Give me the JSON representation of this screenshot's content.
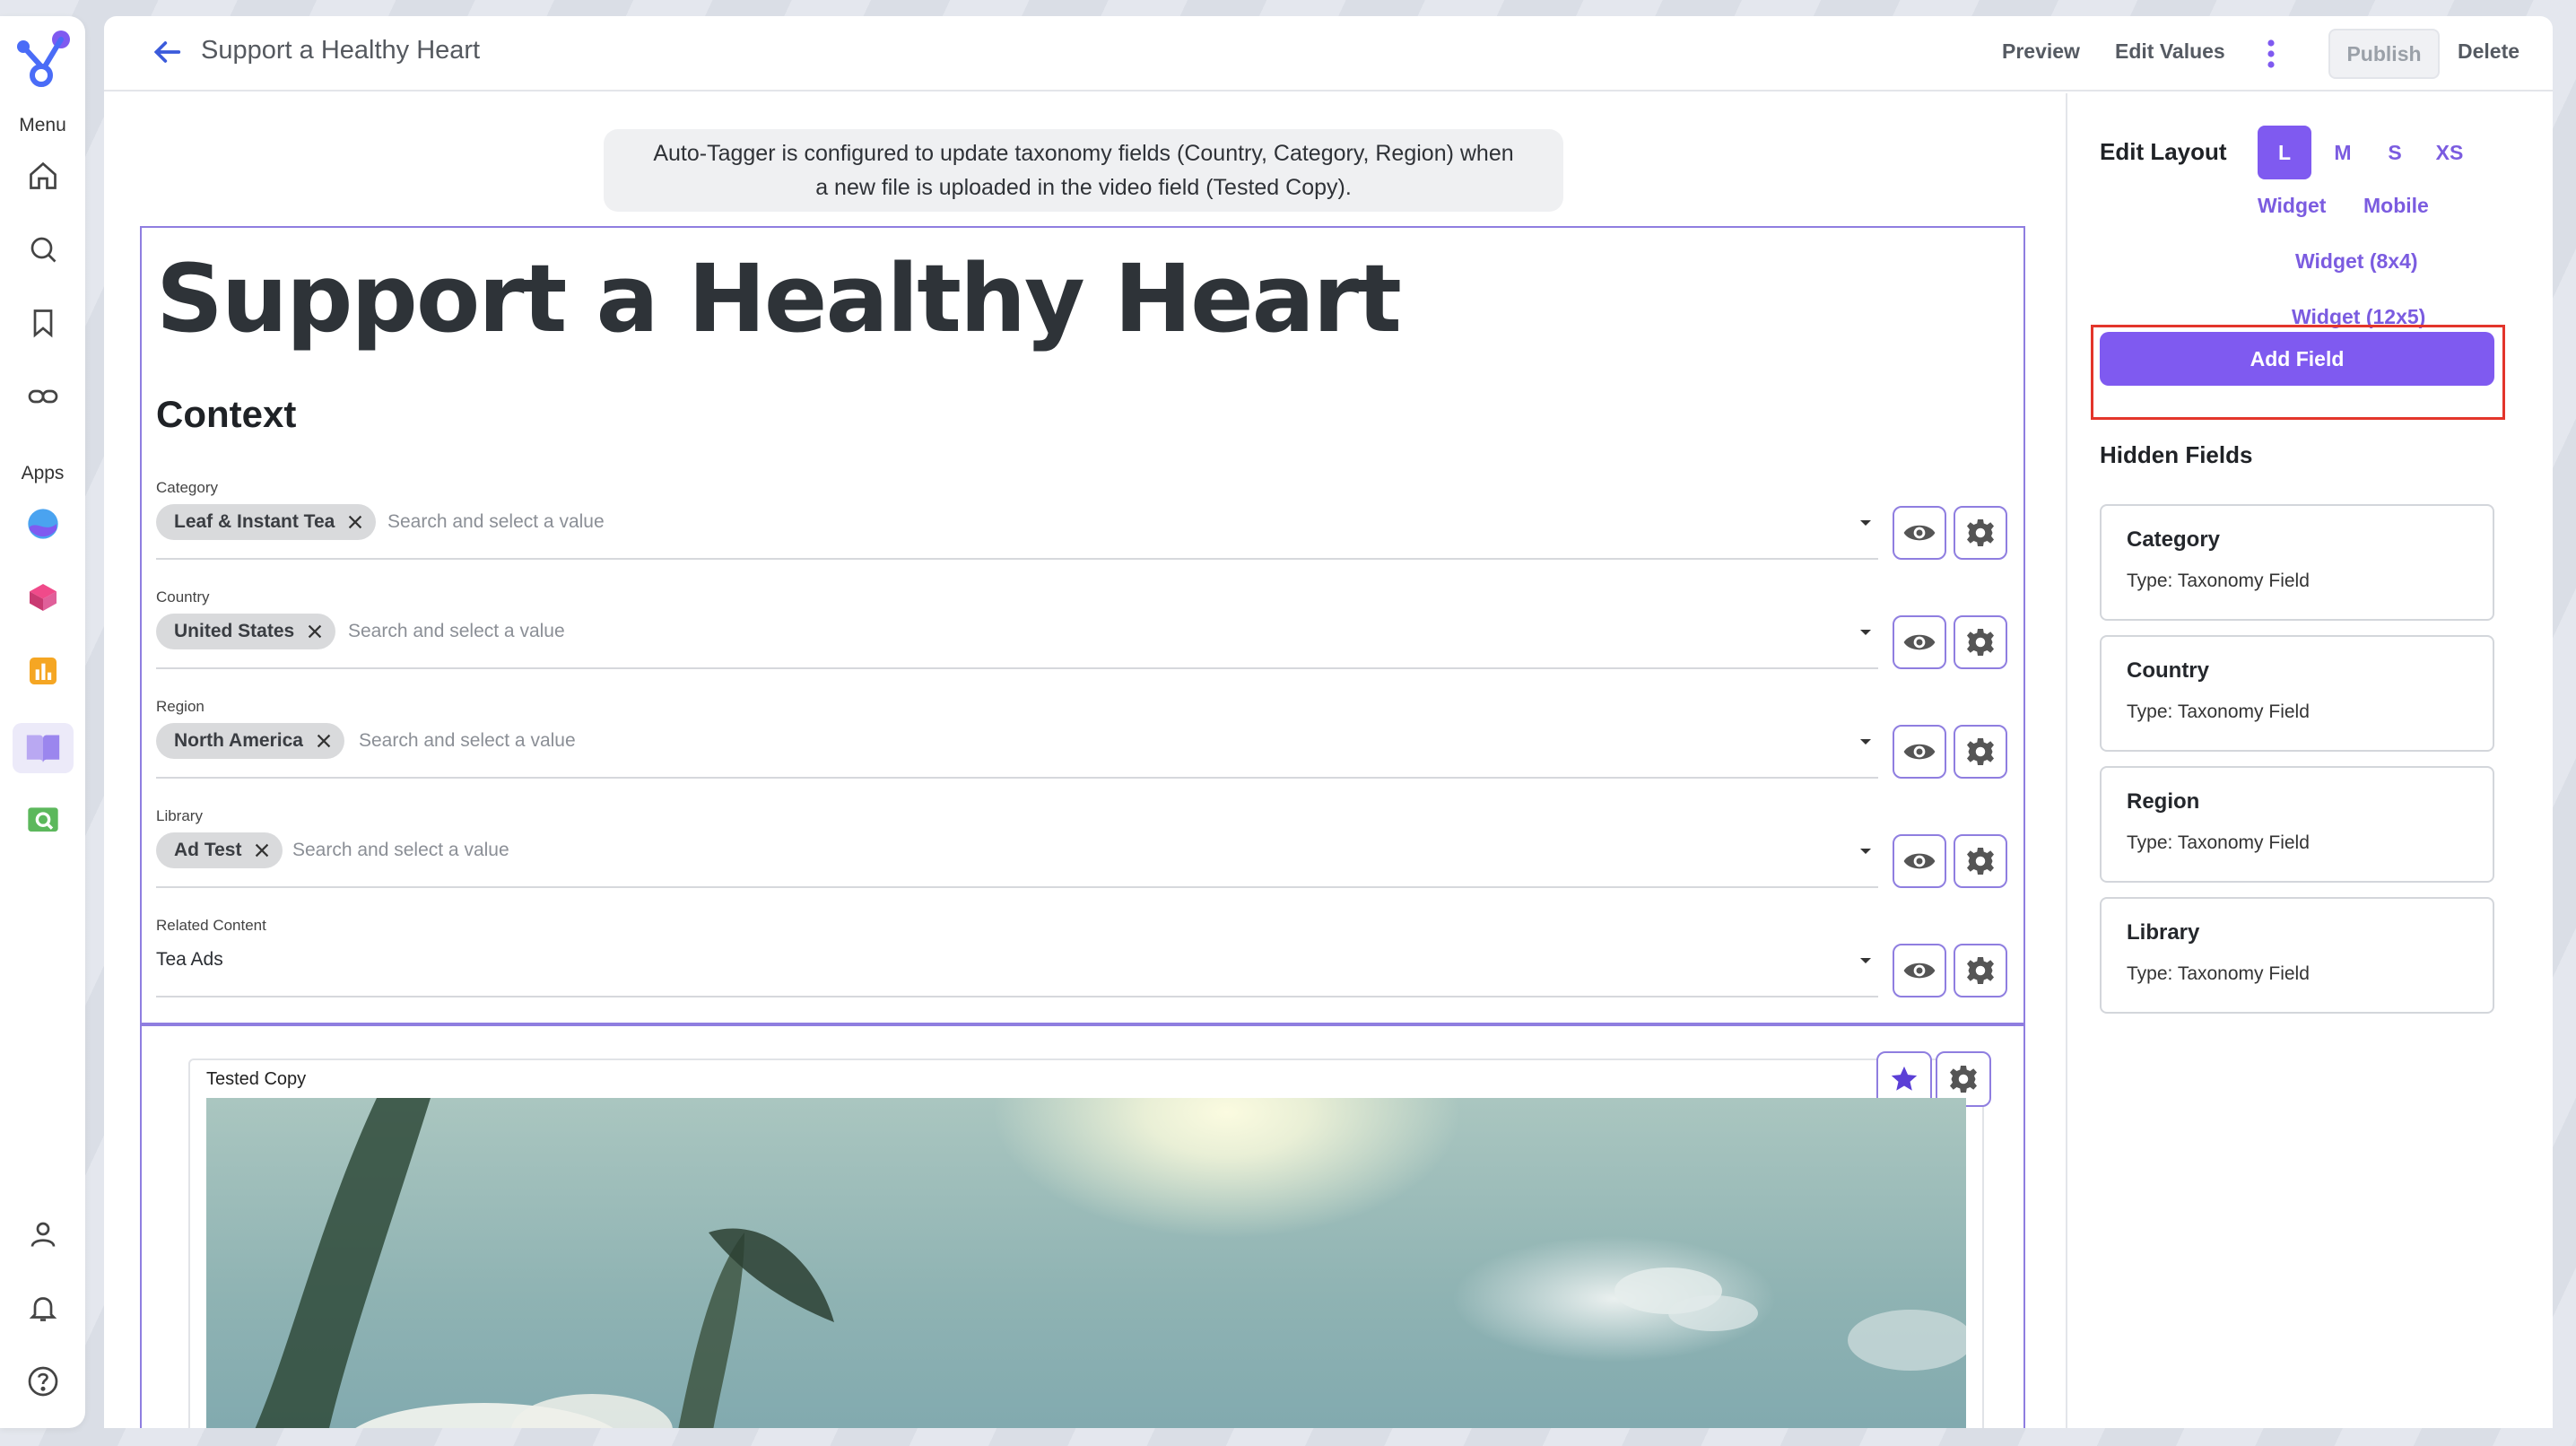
{
  "rail": {
    "menu_label": "Menu",
    "apps_label": "Apps",
    "menu_items": [
      {
        "icon": "home-icon"
      },
      {
        "icon": "search-icon"
      },
      {
        "icon": "bookmark-icon"
      },
      {
        "icon": "link-icon"
      }
    ],
    "app_items": [
      {
        "icon": "app-globe-icon"
      },
      {
        "icon": "app-cube-icon"
      },
      {
        "icon": "app-chart-icon"
      },
      {
        "icon": "app-book-icon"
      },
      {
        "icon": "app-search-folder-icon"
      }
    ],
    "bottom_items": [
      {
        "icon": "user-icon"
      },
      {
        "icon": "bell-icon"
      },
      {
        "icon": "help-icon"
      }
    ],
    "accent": "#7f5af0"
  },
  "header": {
    "title": "Support a Healthy Heart",
    "preview_label": "Preview",
    "edit_values_label": "Edit Values",
    "publish_label": "Publish",
    "delete_label": "Delete"
  },
  "notice": {
    "line1": "Auto-Tagger is configured to update taxonomy fields (Country, Category, Region) when",
    "line2": "a new file is uploaded in the video field (Tested Copy)."
  },
  "document": {
    "heading": "Support a Healthy Heart",
    "section": "Context",
    "placeholder": "Search and select a value",
    "fields": [
      {
        "label": "Category",
        "chip": "Leaf & Instant Tea"
      },
      {
        "label": "Country",
        "chip": "United States"
      },
      {
        "label": "Region",
        "chip": "North America"
      },
      {
        "label": "Library",
        "chip": "Ad Test"
      }
    ],
    "related": {
      "label": "Related Content",
      "value": "Tea Ads"
    },
    "video": {
      "label": "Tested Copy"
    }
  },
  "side": {
    "edit_layout_label": "Edit Layout",
    "sizes": [
      "L",
      "M",
      "S",
      "XS"
    ],
    "active_size": "L",
    "widget_label": "Widget",
    "mobile_label": "Mobile",
    "widget_8x4_label": "Widget (8x4)",
    "widget_12x5_label": "Widget (12x5)",
    "add_field_label": "Add Field",
    "hidden_fields_label": "Hidden Fields",
    "hidden_fields": [
      {
        "name": "Category",
        "type": "Type: Taxonomy Field"
      },
      {
        "name": "Country",
        "type": "Type: Taxonomy Field"
      },
      {
        "name": "Region",
        "type": "Type: Taxonomy Field"
      },
      {
        "name": "Library",
        "type": "Type: Taxonomy Field"
      }
    ]
  }
}
